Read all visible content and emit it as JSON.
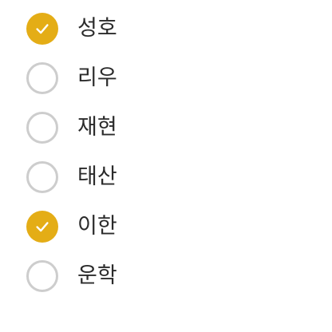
{
  "colors": {
    "checked_fill": "#e4ad16",
    "unchecked_border": "#cdcdcd",
    "checkmark": "#ffffff",
    "label_text": "#2b2b2b"
  },
  "options": [
    {
      "label": "성호",
      "checked": true
    },
    {
      "label": "리우",
      "checked": false
    },
    {
      "label": "재현",
      "checked": false
    },
    {
      "label": "태산",
      "checked": false
    },
    {
      "label": "이한",
      "checked": true
    },
    {
      "label": "운학",
      "checked": false
    }
  ],
  "icons": {
    "checked": "checkmark-icon",
    "unchecked": "empty-circle-icon"
  }
}
